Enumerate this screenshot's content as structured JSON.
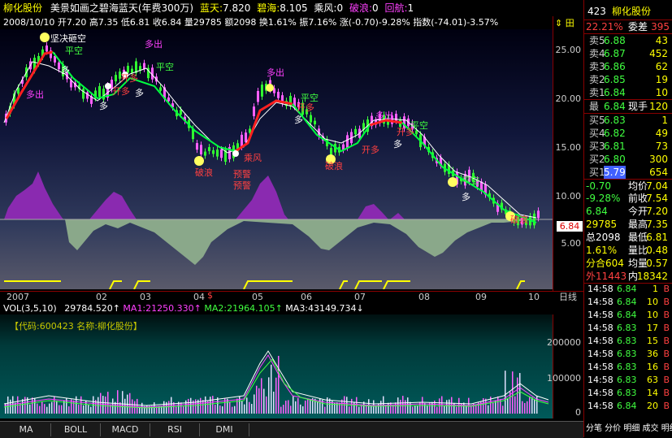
{
  "header": {
    "stock_name": "柳化股份",
    "indicator": "美景如画之碧海蓝天(年费300万)",
    "lantian_label": "蓝天:",
    "lantian_value": "7.820",
    "bihai_label": "碧海:",
    "bihai_value": "8.105",
    "chengfeng_label": "乘风:",
    "chengfeng_value": "0",
    "polang_label": "破浪:",
    "polang_value": "0",
    "huihang_label": "回航:",
    "huihang_value": "1"
  },
  "info_line": {
    "date": "2008/10/10",
    "open": "开7.20",
    "high": "高7.35",
    "low": "低6.81",
    "close": "收6.84",
    "volume": "量29785",
    "amount": "额2098",
    "turnover": "换1.61%",
    "amplitude": "振7.16%",
    "change": "涨(-0.70)-9.28%",
    "index": "指数(-74.01)-3.57%"
  },
  "main_axis": {
    "ticks": [
      "25.00",
      "20.00",
      "15.00",
      "10.00",
      "5.00"
    ],
    "current_price": "6.84",
    "icons_top": "⇕ 田"
  },
  "annotations": [
    "坚决砸空",
    "多出",
    "多出",
    "多出",
    "多出",
    "多",
    "多",
    "多",
    "多",
    "多",
    "多",
    "开多",
    "开多",
    "开多",
    "开多",
    "开多",
    "平空",
    "平空",
    "平空",
    "平空",
    "平空",
    "预警",
    "预警",
    "乘风",
    "破浪",
    "破浪",
    "破浪"
  ],
  "date_axis": {
    "labels": [
      "2007",
      "02",
      "03",
      "04",
      "05",
      "06",
      "07",
      "08",
      "09",
      "10"
    ],
    "period": "日线"
  },
  "vol_header": {
    "title": "VOL(3,5,10)",
    "vol": "29784.520",
    "ma1": "MA1:21250.330",
    "ma2": "MA2:21964.105",
    "ma3": "MA3:43149.734",
    "info": "【代码:600423 名称:柳化股份】"
  },
  "vol_axis": {
    "ticks": [
      "200000",
      "100000",
      "0"
    ]
  },
  "tabs": [
    "MA",
    "BOLL",
    "MACD",
    "RSI",
    "DMI"
  ],
  "right_panel": {
    "code": "423",
    "name": "柳化股份",
    "weibi_label": "22.21%",
    "weicha_label": "委差",
    "weicha_value": "395",
    "asks": [
      {
        "label": "卖5",
        "price": "6.88",
        "vol": "43"
      },
      {
        "label": "卖4",
        "price": "6.87",
        "vol": "452"
      },
      {
        "label": "卖3",
        "price": "6.86",
        "vol": "62"
      },
      {
        "label": "卖2",
        "price": "6.85",
        "vol": "19"
      },
      {
        "label": "卖1",
        "price": "6.84",
        "vol": "10"
      }
    ],
    "last_label": "最",
    "last_price": "6.84",
    "xianshou_label": "现手",
    "xianshou_value": "120",
    "bids": [
      {
        "label": "买5",
        "price": "6.83",
        "vol": "1"
      },
      {
        "label": "买4",
        "price": "6.82",
        "vol": "49"
      },
      {
        "label": "买3",
        "price": "6.81",
        "vol": "73"
      },
      {
        "label": "买2",
        "price": "6.80",
        "vol": "300"
      },
      {
        "label": "买1",
        "price": "5.79",
        "vol": "654"
      }
    ],
    "stats": [
      {
        "l": "-0.70",
        "r": "均价",
        "v": "7.04"
      },
      {
        "l": "-9.28%",
        "r": "前收",
        "v": "7.54"
      },
      {
        "l": "6.84",
        "r": "今开",
        "v": "7.20"
      },
      {
        "l": "29785",
        "r": "最高",
        "v": "7.35"
      },
      {
        "l": "总2098",
        "r": "最低",
        "v": "6.81"
      },
      {
        "l": "1.61%",
        "r": "量比",
        "v": "0.48"
      },
      {
        "l": "分合604",
        "r": "均量",
        "v": "0.57"
      },
      {
        "l": "外11443",
        "r": "内",
        "v": "18342"
      }
    ],
    "trades": [
      {
        "t": "14:58",
        "p": "6.84",
        "v": "1",
        "s": "B"
      },
      {
        "t": "14:58",
        "p": "6.84",
        "v": "10",
        "s": "B"
      },
      {
        "t": "14:58",
        "p": "6.84",
        "v": "10",
        "s": "B"
      },
      {
        "t": "14:58",
        "p": "6.83",
        "v": "17",
        "s": "B"
      },
      {
        "t": "14:58",
        "p": "6.83",
        "v": "15",
        "s": "B"
      },
      {
        "t": "14:58",
        "p": "6.83",
        "v": "36",
        "s": "B"
      },
      {
        "t": "14:58",
        "p": "6.83",
        "v": "16",
        "s": "B"
      },
      {
        "t": "14:58",
        "p": "6.83",
        "v": "63",
        "s": "B"
      },
      {
        "t": "14:58",
        "p": "6.83",
        "v": "14",
        "s": "B"
      },
      {
        "t": "14:58",
        "p": "6.84",
        "v": "20",
        "s": "B"
      }
    ],
    "bottom_text": "分笔 分价 明细 成交 明细"
  }
}
